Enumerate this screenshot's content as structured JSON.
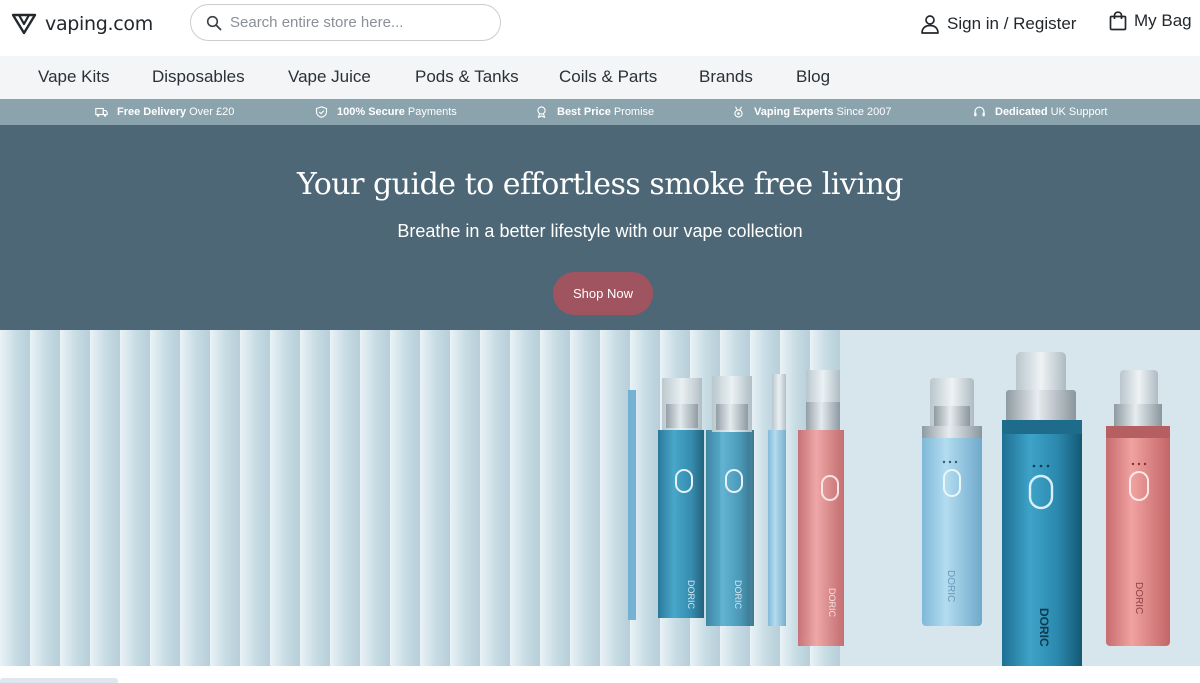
{
  "header": {
    "logo_text": "vaping.com",
    "search_placeholder": "Search entire store here...",
    "account_label": "Sign in / Register",
    "bag_label": "My Bag"
  },
  "nav": {
    "items": [
      "Vape Kits",
      "Disposables",
      "Vape Juice",
      "Pods & Tanks",
      "Coils & Parts",
      "Brands",
      "Blog"
    ]
  },
  "usp_bar": {
    "items": [
      {
        "bold": "Free Delivery",
        "text": "Over £20",
        "icon": "truck-icon"
      },
      {
        "bold": "100% Secure",
        "text": "Payments",
        "icon": "shield-check-icon"
      },
      {
        "bold": "Best Price",
        "text": "Promise",
        "icon": "award-icon"
      },
      {
        "bold": "Vaping Experts",
        "text": "Since 2007",
        "icon": "medal-icon"
      },
      {
        "bold": "Dedicated",
        "text": "UK Support",
        "icon": "headset-icon"
      }
    ]
  },
  "hero": {
    "title": "Your guide to effortless smoke free living",
    "subtitle": "Breathe in a better lifestyle with our vape collection",
    "cta_label": "Shop Now"
  },
  "banner": {
    "device_label": "DORIC"
  },
  "colors": {
    "hero_bg": "#4d6776",
    "usp_bg": "#8aa3ad",
    "nav_bg": "#f3f5f6",
    "cta_bg": "#a0545f"
  }
}
